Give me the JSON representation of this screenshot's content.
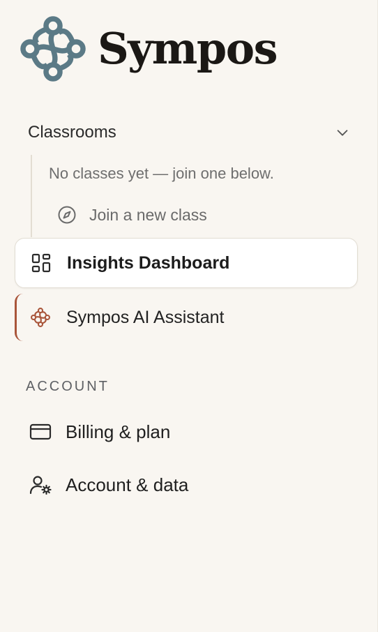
{
  "brand": {
    "name": "Sympos",
    "logo_icon": "sympos-knot-logo",
    "logo_color": "#5b7a86"
  },
  "classrooms": {
    "label": "Classrooms",
    "toggle_icon": "chevron-down-icon",
    "empty_message": "No classes yet — join one below.",
    "join_label": "Join a new class",
    "join_icon": "compass-icon"
  },
  "nav": {
    "insights_label": "Insights Dashboard",
    "insights_icon": "dashboard-grid-icon",
    "assistant_label": "Sympos AI Assistant",
    "assistant_icon": "sympos-knot-icon",
    "accent_color": "#a9553a"
  },
  "account": {
    "heading": "ACCOUNT",
    "billing_label": "Billing & plan",
    "billing_icon": "credit-card-icon",
    "data_label": "Account & data",
    "data_icon": "user-settings-icon"
  }
}
